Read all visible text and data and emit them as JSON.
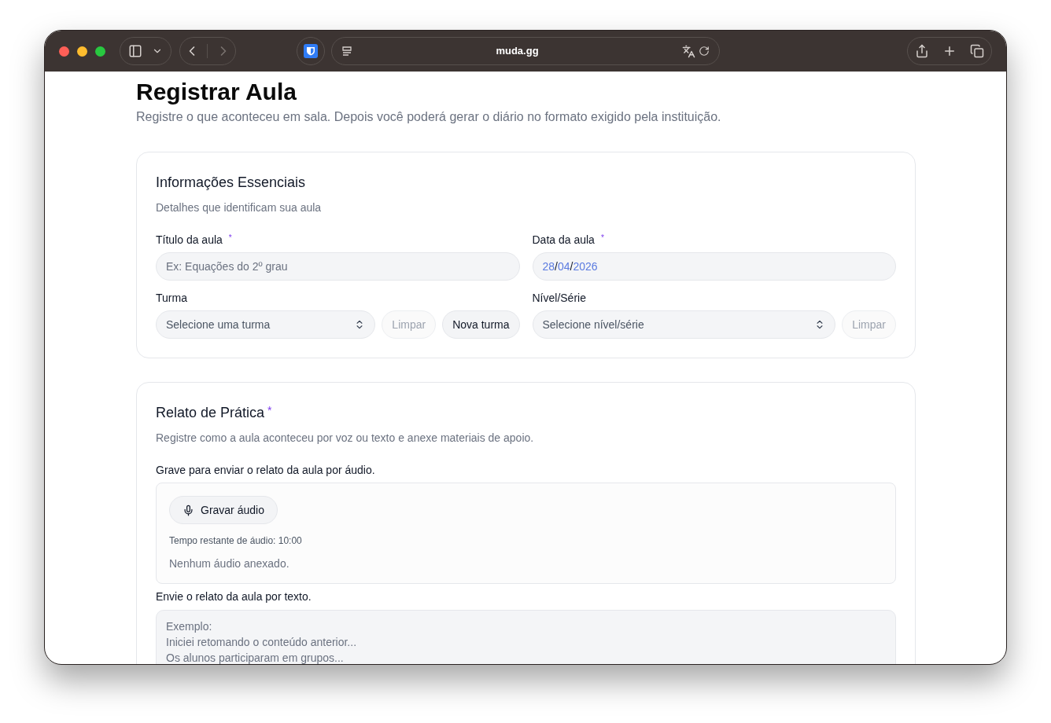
{
  "browser": {
    "url": "muda.gg",
    "back_disabled": false,
    "forward_disabled": true
  },
  "page": {
    "title": "Registrar Aula",
    "subtitle": "Registre o que aconteceu em sala. Depois você poderá gerar o diário no formato exigido pela instituição."
  },
  "essentials": {
    "title": "Informações Essenciais",
    "description": "Detalhes que identificam sua aula",
    "title_field": {
      "label": "Título da aula",
      "required_mark": "*",
      "placeholder": "Ex: Equações do 2º grau"
    },
    "date_field": {
      "label": "Data da aula",
      "required_mark": "*",
      "day": "28",
      "month": "04",
      "year": "2026",
      "separator": "/"
    },
    "class_field": {
      "label": "Turma",
      "placeholder": "Selecione uma turma",
      "buttons": [
        {
          "label": "Limpar",
          "disabled": true
        },
        {
          "label": "Nova turma",
          "disabled": false
        }
      ]
    },
    "level_field": {
      "label": "Nível/Série",
      "placeholder": "Selecione nível/série",
      "buttons": [
        {
          "label": "Limpar",
          "disabled": true
        }
      ]
    }
  },
  "practice": {
    "title": "Relato de Prática",
    "required_mark": "*",
    "description": "Registre como a aula aconteceu por voz ou texto e anexe materiais de apoio.",
    "audio": {
      "label": "Grave para enviar o relato da aula por áudio.",
      "record_button": "Gravar áudio",
      "remaining": "Tempo restante de áudio: 10:00",
      "status": "Nenhum áudio anexado."
    },
    "text": {
      "label": "Envie o relato da aula por texto.",
      "placeholder_lines": [
        "Exemplo:",
        "Iniciei retomando o conteúdo anterior...",
        "Os alunos participaram em grupos..."
      ]
    }
  }
}
